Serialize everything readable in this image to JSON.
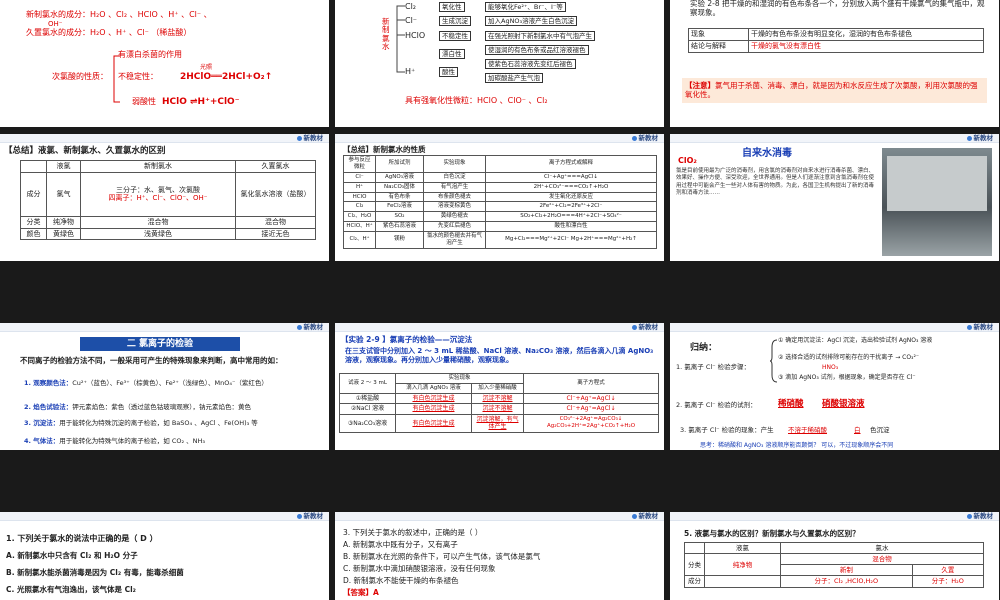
{
  "brand": "新教材",
  "s1": {
    "l1_label": "新制氯水的成分：",
    "l1_value": "H₂O 、Cl₂ 、HClO 、H⁺ 、Cl⁻ 、",
    "l1_tail": "OH⁻",
    "l2_label": "久置氯水的成分：",
    "l2_value": "H₂O 、H⁺ 、Cl⁻ （稀盐酸）",
    "bleach": "有漂白杀菌的作用",
    "prop_label": "次氯酸的性质：",
    "unstable": "不稳定性：",
    "cond": "光照",
    "eq": "2HClO══2HCl+O₂↑",
    "weak": "弱酸性",
    "eq2": "HClO ⇌H⁺+ClO⁻"
  },
  "s2": {
    "vlabel": "新制氯水",
    "species": [
      "Cl₂",
      "Cl⁻",
      "HClO",
      "H⁺"
    ],
    "props": [
      "氧化性",
      "生成沉淀",
      "不稳定性",
      "漂白性",
      "酸性"
    ],
    "effects": [
      "能够氧化Fe²⁺、Br⁻、I⁻等",
      "加入AgNO₃溶液产生白色沉淀",
      "在强光照射下新制氯水中有气泡产生",
      "使湿润的有色布条或品红溶液褪色",
      "使紫色石蕊溶液先变红后褪色",
      "加碳酸盐产生气泡"
    ],
    "foot_label": "具有强氧化性微粒：",
    "foot_value": "HClO 、ClO⁻ 、Cl₂"
  },
  "s3": {
    "intro": "实验 2-8 把干燥的和湿润的有色布条各一个，分别放入两个盛有干燥氯气的集气瓶中，观察现象。",
    "rows": [
      {
        "k": "现象",
        "v": "干燥的有色布条没有明显变化，湿润的有色布条褪色"
      },
      {
        "k": "结论与解释",
        "v": "干燥的氯气没有漂白性"
      }
    ],
    "note_label": "【注意】",
    "note": "氯气用于杀菌、消毒、漂白，就是因为和水反应生成了次氯酸，利用次氯酸的强氧化性。"
  },
  "s4": {
    "title": "【总结】液氯、新制氯水、久置氯水的区别",
    "head": [
      "",
      "液氯",
      "新制氯水",
      "久置氯水"
    ],
    "row1_k": "成分",
    "row1_a": "氯气",
    "row1_b1": "三分子：水、氯气、次氯酸",
    "row1_b2": "四离子：H⁺、Cl⁻、ClO⁻、OH⁻",
    "row1_c": "氯化氢水溶液（盐酸）",
    "row2": [
      "分类",
      "纯净物",
      "混合物",
      "混合物"
    ],
    "row3": [
      "颜色",
      "黄绿色",
      "浅黄绿色",
      "接近无色"
    ]
  },
  "s5": {
    "title": "【总结】新制氯水的性质",
    "head": [
      "参与反应微粒",
      "所加试剂",
      "实验现象",
      "离子方程式或解释"
    ],
    "rows": [
      [
        "Cl⁻",
        "AgNO₃溶液",
        "白色沉淀",
        "Cl⁻+Ag⁺===AgCl↓"
      ],
      [
        "H⁺",
        "Na₂CO₃固体",
        "有气泡产生",
        "2H⁺+CO₃²⁻===CO₂↑+H₂O"
      ],
      [
        "HClO",
        "有色布条",
        "布条颜色褪去",
        "发生氧化还原反应"
      ],
      [
        "Cl₂",
        "FeCl₂溶液",
        "溶液变棕黄色",
        "2Fe²⁺+Cl₂=2Fe³⁺+2Cl⁻"
      ],
      [
        "Cl₂、H₂O",
        "SO₂",
        "黄绿色褪去",
        "SO₂+Cl₂+2H₂O===4H⁺+2Cl⁻+SO₄²⁻"
      ],
      [
        "HClO、H⁺",
        "紫色石蕊溶液",
        "先变红后褪色",
        "酸性和漂白性"
      ],
      [
        "Cl₂、H⁺",
        "镁粉",
        "氯水的颜色褪去并有气泡产生",
        "Mg+Cl₂===Mg²⁺+2Cl⁻ Mg+2H⁺===Mg²⁺+H₂↑"
      ]
    ]
  },
  "s6": {
    "badge": "ClO₂",
    "title": "自来水消毒",
    "body": "氯是目前使用最为广泛的消毒剂，用含氯的消毒剂对自来水进行消毒杀菌、漂白、效果好、操作方便、深受欢迎，全世界通用。但是人们逐渐注意到含氯消毒剂在使用过程中可能会产生一些对人体有害的物质。为此，各国卫生机构提出了新的消毒剂和消毒方法……"
  },
  "s7": {
    "title": "二  氯离子的检验",
    "intro": "不同离子的检验方法不同，一般采用可产生的特殊现象来判断，高中常用的如：",
    "items": [
      {
        "n": "1. 观察颜色法：",
        "t": "Cu²⁺（蓝色）、Fe³⁺（棕黄色）、Fe²⁺（浅绿色）、MnO₄⁻（紫红色）"
      },
      {
        "n": "2. 焰色试验法：",
        "t": "钾元素焰色：紫色（透过蓝色钴玻璃观察），钠元素焰色：黄色"
      },
      {
        "n": "3. 沉淀法：",
        "t": "用于能转化为特殊沉淀的离子检验，如 BaSO₄ 、AgCl 、Fe(OH)₃ 等"
      },
      {
        "n": "4. 气体法：",
        "t": "用于能转化为特殊气体的离子检验，如 CO₂ 、NH₃"
      }
    ]
  },
  "s8": {
    "title": "【实验 2-9 】氯离子的检验——沉淀法",
    "intro": "在三支试管中分别加入 2 ～ 3 mL 稀盐酸、NaCl 溶液、Na₂CO₃ 溶液，然后各滴入几滴 AgNO₃ 溶液，观察现象。再分别加入少量稀硝酸，观察现象。",
    "head_phen": "实验现象",
    "head": [
      "试液 2 ～ 3 mL",
      "滴入几滴 AgNO₃ 溶液",
      "加入少量稀硝酸",
      "离子方程式"
    ],
    "rows": [
      [
        "①稀盐酸",
        "有白色沉淀生成",
        "沉淀不溶解",
        "Cl⁻+Ag⁺=AgCl↓"
      ],
      [
        "②NaCl 溶液",
        "有白色沉淀生成",
        "沉淀不溶解",
        "Cl⁻+Ag⁺=AgCl↓"
      ],
      [
        "③Na₂CO₃溶液",
        "有白色沉淀生成",
        "沉淀溶解，有气体产生",
        "CO₃²⁻+2Ag⁺=Ag₂CO₃↓ Ag₂CO₃+2H⁺=2Ag⁺+CO₂↑+H₂O"
      ]
    ]
  },
  "s9": {
    "title": "归纳：",
    "l1": "1. 氯离子 Cl⁻ 检验步骤：",
    "s1": "① 确定用沉淀法：AgCl 沉淀，选出检验试剂 AgNO₃ 溶液",
    "s2": "② 选择合适的试剂排除可能存在的干扰离子 → CO₃²⁻",
    "s2b": "HNO₃",
    "s3": "③ 滴加 AgNO₃ 试剂，根据现象，确定是否存在 Cl⁻",
    "l2": "2. 氯离子 Cl⁻ 检验的试剂：",
    "a1": "稀硝酸",
    "a2": "硝酸银溶液",
    "l3": "3. 氯离子 Cl⁻ 检验的现象：产生",
    "a3": "不溶于稀硝酸",
    "a4": "白",
    "l3b": "色沉淀",
    "think": "思考：稀硝酸和 AgNO₃ 溶液顺序能否颠倒？  可以，不过现象顺序会不同"
  },
  "s10": {
    "q": "1. 下列关于氯水的说法中正确的是（ D ）",
    "opts": [
      "A. 新制氯水中只含有 Cl₂ 和 H₂O 分子",
      "B. 新制氯水能杀菌消毒是因为 Cl₂ 有毒，能毒杀细菌",
      "C. 光照氯水有气泡逸出，该气体是 Cl₂"
    ]
  },
  "s11": {
    "q": "3. 下列关于氯水的叙述中，正确的是（    ）",
    "opts": [
      "A. 新制氯水中既有分子，又有离子",
      "B. 新制氯水在光照的条件下，可以产生气体，该气体是氯气",
      "C. 新制氯水中滴加硝酸银溶液，没有任何现象",
      "D. 新制氯水不能使干燥的布条褪色"
    ],
    "ans": "【答案】A"
  },
  "s12": {
    "q": "5. 液氯与氯水的区别？新制氯水与久置氯水的区别？",
    "h1": "液氯",
    "h2": "氯水",
    "mix": "混合物",
    "k1": "分类",
    "pure": "纯净物",
    "new": "新制",
    "old": "久置",
    "k2": "成分",
    "c1": "分子：Cl₂ ,HClO,H₂O",
    "c2": "分子：H₂O"
  }
}
